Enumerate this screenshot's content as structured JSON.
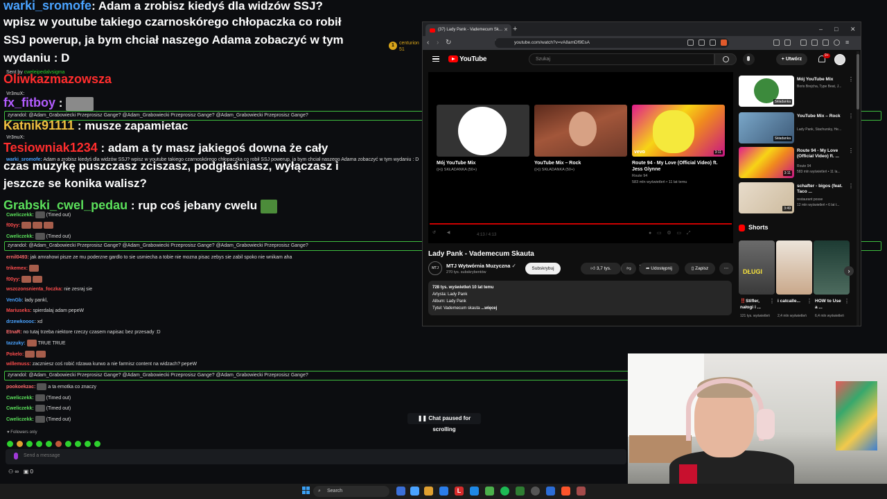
{
  "chat": {
    "big_lines": [
      {
        "user": "warki_sromofe",
        "text": ": Adam a zrobisz kiedyś dla widzów SSJ?"
      },
      {
        "user": "",
        "text": "wpisz w youtube takiego czarnoskórego chłopaczka co robił"
      },
      {
        "user": "",
        "text": "SSJ powerup, ja bym chciał naszego Adama zobaczyć w tym"
      },
      {
        "user": "",
        "text": "wydaniu : D"
      },
      {
        "user": "Oliwkazmazowsza",
        "text": ""
      },
      {
        "user": "fx_fitboy",
        "text": " :"
      },
      {
        "user": "Katnik91111",
        "text": " : musze zapamietac"
      },
      {
        "user": "Tesiowniak1234",
        "text": " : adam a ty masz jakiegoś downa że cały"
      },
      {
        "user": "",
        "text": "czas muzykę puszczasz zciszasz, podgłaśniasz, wyłączasz i"
      },
      {
        "user": "",
        "text": "jeszcze se konika walisz?"
      },
      {
        "user": "Grabski_cwel_pedau",
        "text": " : rup coś jebany cwelu"
      }
    ],
    "sent_by": "Sent by",
    "sent_by_user": "cweleipedalvsigma",
    "highlight_text": "zyrandol: @Adam_Grabowiecki Przeprosisz Gange? @Adam_Grabowiecki Przeprosisz Gange? @Adam_Grabowiecki Przeprosisz Gange?",
    "small_lines": [
      {
        "user": "Vr3nuX:",
        "text": ""
      },
      {
        "user": "Vr3nuX:",
        "text": ""
      },
      {
        "user": "warki_sromofe:",
        "text": "Adam a zrobisz kiedyś dla widzów SSJ? wpisz w youtube takiego czarnoskórego chłopaczka co robił SSJ powerup, ja bym chciał naszego Adama zobaczyć w tym wydaniu : D"
      },
      {
        "user": "Cweliczekk:",
        "text": "(Timed out)"
      },
      {
        "user": "Cweliczekk:",
        "text": "(Timed out)"
      },
      {
        "user": "ernil0493:",
        "text": "jak amrahowi pisze ze mu poderzne gardlo to sie usmiecha a tobie nie mozna pisac zebys sie zabil spoko nie wnikam aha"
      },
      {
        "user": "wszczonsnienta_foczka:",
        "text": "nie zesraj sie"
      },
      {
        "user": "VenGb:",
        "text": "lady pankl,"
      },
      {
        "user": "Mariuseks:",
        "text": "spierdalaj adam pepeW"
      },
      {
        "user": "drzewkoooc:",
        "text": "xd"
      },
      {
        "user": "EtnaR:",
        "text": "no tutaj trzeba niektore rzeczy czasem napisac bez przesady :D"
      },
      {
        "user": "tazzuky:",
        "text": "TRUE   TRUE"
      },
      {
        "user": "Pokelo:",
        "text": ""
      },
      {
        "user": "willemuss:",
        "text": "zaczniesz coś robić rdzawa kurwo a nie farmisz content na widzach? pepeW"
      },
      {
        "user": "pookoekzac:",
        "text": "a ta emotka co znaczy"
      },
      {
        "user": "Cweliczekk:",
        "text": "(Timed out)"
      },
      {
        "user": "Cweliczekk:",
        "text": "(Timed out)"
      },
      {
        "user": "Cweliczekk:",
        "text": "(Timed out)"
      }
    ],
    "paused_label": "Chat paused for scrolling",
    "followers_only": "Followers only",
    "input_placeholder": "Send a message",
    "bottom_counter": "0",
    "centurion_name": "centurion",
    "centurion_count": "51"
  },
  "browser": {
    "tab_title": "(37) Lady Pank - Vademecum Sk...",
    "url": "youtube.com/watch?v=vA8amDf9EsA"
  },
  "youtube": {
    "logo_text": "YouTube",
    "search_placeholder": "Szukaj",
    "create_label": "Utwórz",
    "notifications_count": "9+",
    "endcards": [
      {
        "title": "Mój YouTube Mix",
        "meta": "((•)) SKŁADANKA (50+)",
        "duration": ""
      },
      {
        "title": "YouTube Mix – Rock",
        "meta": "((•)) SKŁADANKA (50+)",
        "duration": ""
      },
      {
        "title": "Route 94 - My Love (Official Video) ft. Jess Glynne",
        "meta": "Route 94",
        "meta2": "583 mln wyświetleń • 11 lat temu",
        "duration": "3:11"
      }
    ],
    "player_time": "4:13 / 4:13",
    "video_title": "Lady Pank - Vademecum Skauta",
    "channel_name": "MTJ Wytwórnia Muzyczna",
    "channel_subs": "270 tys. subskrybentów",
    "subscribe_label": "Subskrybuj",
    "likes": "3,7 tys.",
    "share_label": "Udostępnij",
    "save_label": "Zapisz",
    "description": {
      "views_line": "728 tys. wyświetleń  10 lat temu",
      "artist": "Artysta: Lady Pank",
      "album": "Album: Lady Pank",
      "title_line": "Tytuł: Vademecum skauta",
      "more": "...więcej"
    },
    "sidebar": [
      {
        "title": "Mój YouTube Mix",
        "meta1": "Boris Brejcha, Type Beat, J...",
        "meta2": "",
        "tag": "Składanka"
      },
      {
        "title": "YouTube Mix – Rock",
        "meta1": "Lady Pank, Stachursky, He...",
        "meta2": "",
        "tag": "Składanka"
      },
      {
        "title": "Route 94 - My Love (Official Video) ft. ...",
        "meta1": "Route 94",
        "meta2": "583 mln wyświetleń • 11 la...",
        "tag": "3:11"
      },
      {
        "title": "schafter - bigos (feat. Taco ...",
        "meta1": "restaurant posse",
        "meta2": "12 mln wyświetleń • 6 lat t...",
        "tag": "3:49"
      }
    ],
    "shorts_title": "Shorts",
    "shorts": [
      {
        "title": "‼️Stifler, nałogi i ...",
        "views": "121 tys. wyświetleń",
        "label": "DŁUGI"
      },
      {
        "title": "i catcalle...",
        "views": "2,4 mln wyświetleń",
        "label": ""
      },
      {
        "title": "HOW to Use a ...",
        "views": "6,4 mln wyświetleń",
        "label": ""
      }
    ]
  },
  "taskbar": {
    "search_label": "Search"
  }
}
